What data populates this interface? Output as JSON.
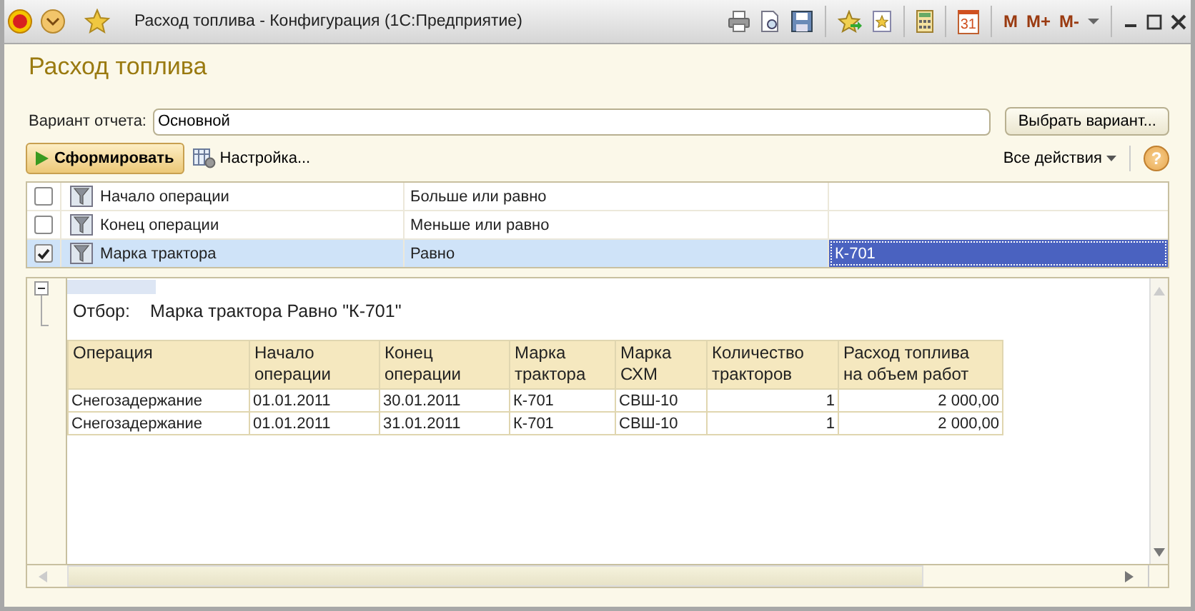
{
  "window": {
    "title": "Расход топлива - Конфигурация  (1С:Предприятие)",
    "calendar_day": "31",
    "memory_buttons": [
      "M",
      "M+",
      "M-"
    ]
  },
  "heading": "Расход топлива",
  "variant": {
    "label": "Вариант отчета:",
    "value": "Основной",
    "choose_button": "Выбрать вариант..."
  },
  "command_bar": {
    "generate": "Сформировать",
    "settings": "Настройка...",
    "all_actions": "Все действия",
    "help": "?"
  },
  "filters": [
    {
      "checked": false,
      "selected": false,
      "field": "Начало операции",
      "condition": "Больше или равно"
    },
    {
      "checked": false,
      "selected": false,
      "field": "Конец операции",
      "condition": "Меньше или равно"
    },
    {
      "checked": true,
      "selected": true,
      "field": "Марка трактора",
      "condition": "Равно",
      "value": "К-701"
    }
  ],
  "report": {
    "filter_label": "Отбор:",
    "filter_text": "Марка трактора Равно \"К-701\"",
    "columns": [
      {
        "label": "Операция",
        "kind": "text"
      },
      {
        "label": "Начало\nоперации",
        "kind": "text"
      },
      {
        "label": "Конец\nоперации",
        "kind": "text"
      },
      {
        "label": "Марка\nтрактора",
        "kind": "text"
      },
      {
        "label": "Марка\nСХМ",
        "kind": "text"
      },
      {
        "label": "Количество\nтракторов",
        "kind": "number"
      },
      {
        "label": "Расход топлива\nна объем работ",
        "kind": "number"
      }
    ],
    "rows": [
      [
        "Снегозадержание",
        "01.01.2011",
        "30.01.2011",
        "К-701",
        "СВШ-10",
        "1",
        "2 000,00"
      ],
      [
        "Снегозадержание",
        "01.01.2011",
        "31.01.2011",
        "К-701",
        "СВШ-10",
        "1",
        "2 000,00"
      ]
    ]
  }
}
